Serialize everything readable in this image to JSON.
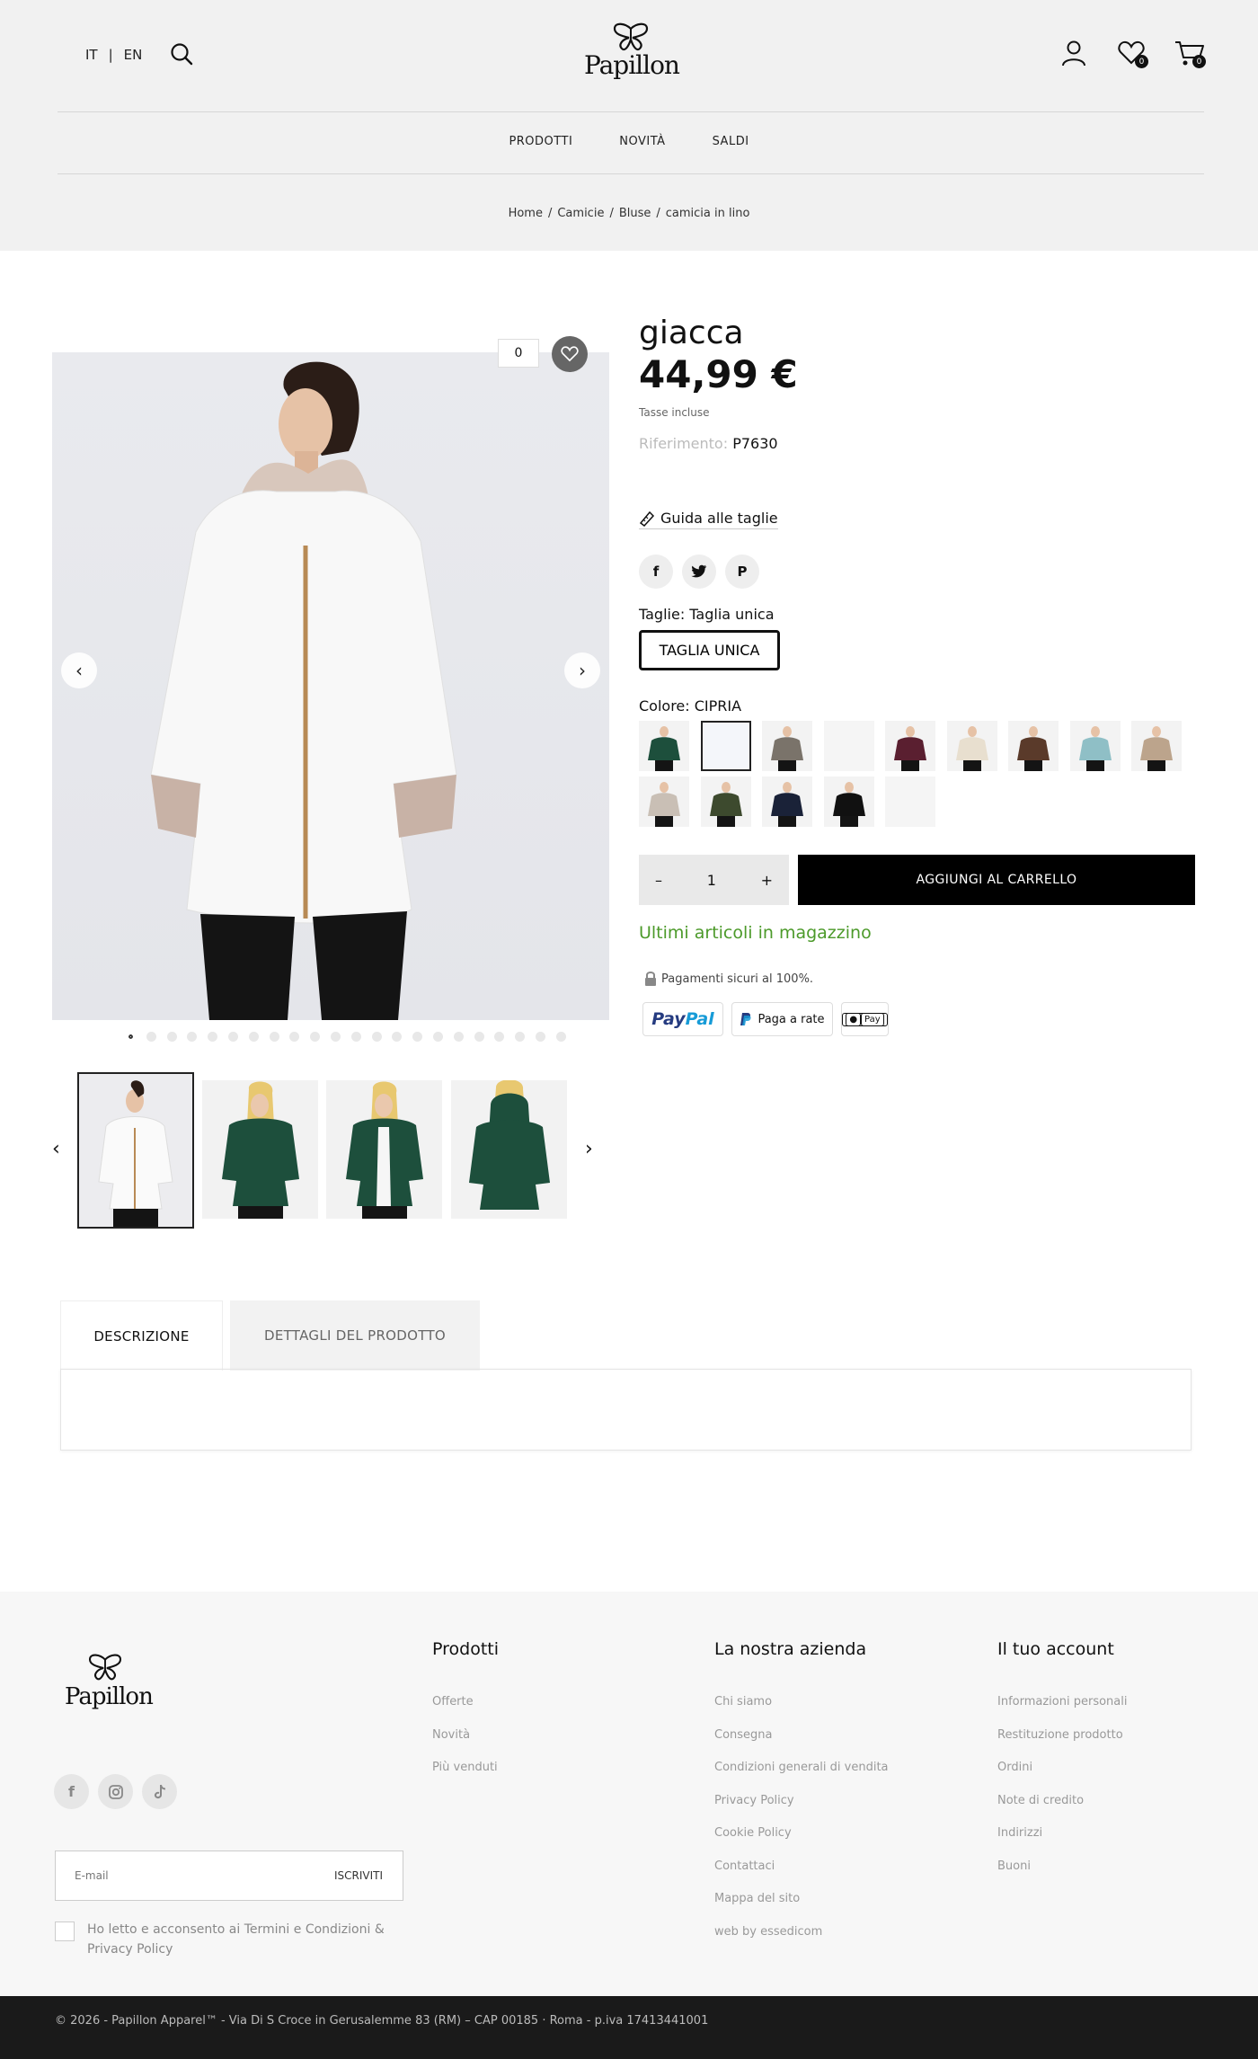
{
  "header": {
    "lang_it": "IT",
    "lang_sep": "|",
    "lang_en": "EN",
    "logo_text": "Papillon",
    "wishlist_count": "0",
    "cart_count": "0"
  },
  "nav": {
    "items": [
      "PRODOTTI",
      "NOVITÀ",
      "SALDI"
    ]
  },
  "breadcrumb": {
    "items": [
      "Home",
      "Camicie",
      "Bluse",
      "camicia in lino"
    ],
    "separator": "/"
  },
  "gallery": {
    "like_count": "0",
    "dots_total": 22,
    "active_dot": 0
  },
  "product": {
    "title": "giacca",
    "price": "44,99 €",
    "tax_note": "Tasse incluse",
    "reference_label": "Riferimento:",
    "reference_value": "P7630",
    "size_guide": "Guida alle taglie",
    "sizes_label": "Taglie: Taglia unica",
    "size_option": "TAGLIA UNICA",
    "color_label": "Colore: CIPRIA",
    "quantity": "1",
    "qty_minus": "–",
    "qty_plus": "+",
    "add_to_cart": "AGGIUNGI AL CARRELLO",
    "stock_status": "Ultimi articoli in magazzino",
    "secure_payments": "Pagamenti sicuri al 100%.",
    "pay_paypal_a": "Pay",
    "pay_paypal_b": "Pal",
    "pay_rate": "Paga a rate",
    "pay_apple": "Pay",
    "social_icons": [
      "facebook-icon",
      "twitter-icon",
      "pinterest-icon"
    ]
  },
  "tabs": {
    "description": "DESCRIZIONE",
    "details": "DETTAGLI DEL PRODOTTO"
  },
  "footer": {
    "logo_text": "Papillon",
    "social_icons": [
      "facebook-icon",
      "instagram-icon",
      "tiktok-icon"
    ],
    "email_placeholder": "E-mail",
    "subscribe": "ISCRIVITI",
    "consent": "Ho letto e acconsento ai Termini e Condizioni & Privacy Policy",
    "col1_title": "Prodotti",
    "col1_links": [
      "Offerte",
      "Novità",
      "Più venduti"
    ],
    "col2_title": "La nostra azienda",
    "col2_links": [
      "Chi siamo",
      "Consegna",
      "Condizioni generali di vendita",
      "Privacy Policy",
      "Cookie Policy",
      "Contattaci",
      "Mappa del sito",
      "web by essedicom"
    ],
    "col3_title": "Il tuo account",
    "col3_links": [
      "Informazioni personali",
      "Restituzione prodotto",
      "Ordini",
      "Note di credito",
      "Indirizzi",
      "Buoni"
    ],
    "copyright": "© 2026 - Papillon Apparel™ - Via Di S Croce in Gerusalemme 83 (RM) – CAP 00185 · Roma - p.iva 17413441001"
  },
  "colors": {
    "accent_black": "#000000",
    "stock_green": "#4c9a2a",
    "header_bg": "#f1f1f1",
    "footer_bg": "#f7f7f7",
    "bottom_bar_bg": "#1a1a1a"
  }
}
